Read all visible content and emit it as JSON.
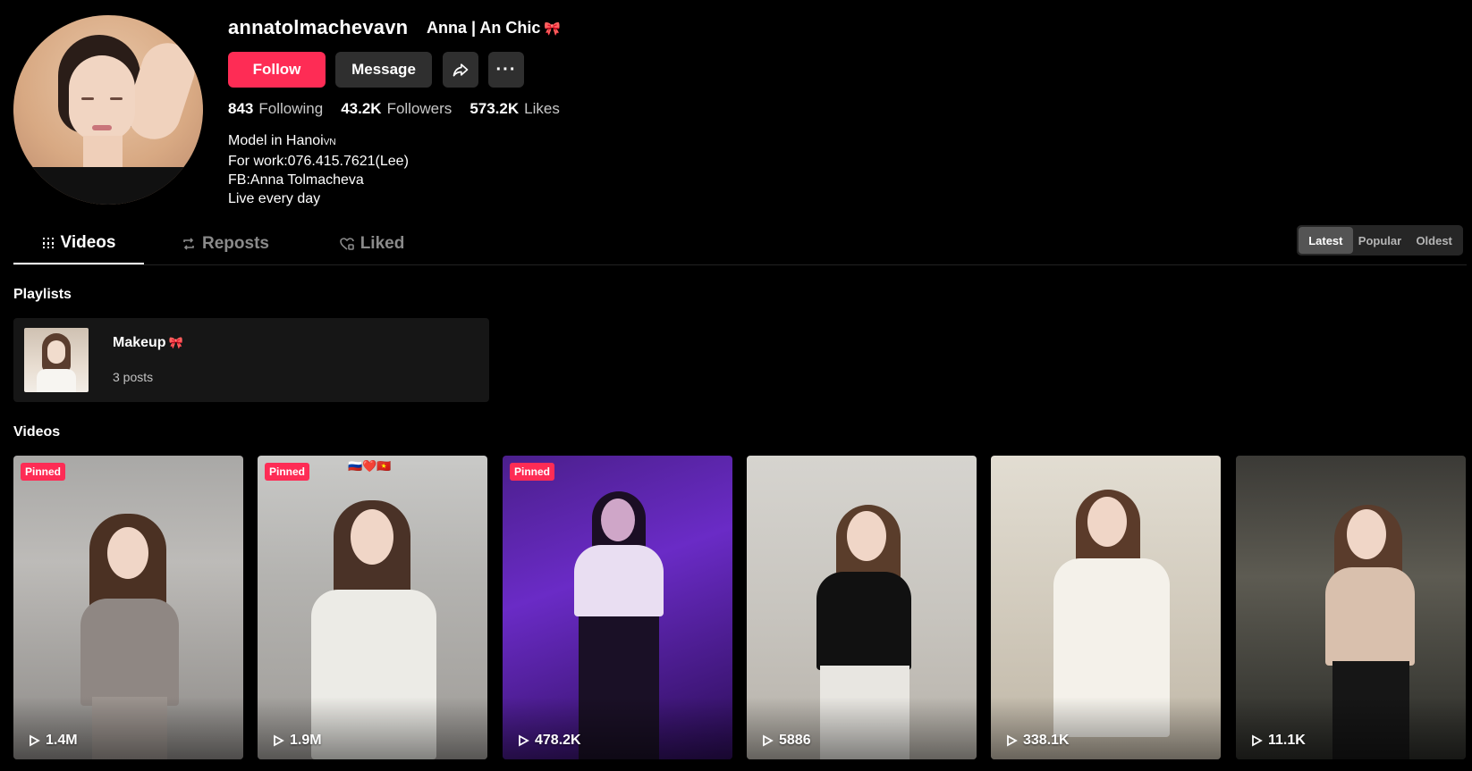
{
  "profile": {
    "username": "annatolmachevavn",
    "nickname": "Anna | An Chic",
    "nickname_emoji": "🎀",
    "follow_label": "Follow",
    "message_label": "Message",
    "more_label": "···",
    "stats": {
      "following_count": "843",
      "following_label": "Following",
      "followers_count": "43.2K",
      "followers_label": "Followers",
      "likes_count": "573.2K",
      "likes_label": "Likes"
    },
    "bio": {
      "line1": "Model in Hanoi",
      "line1_suffix": "VN",
      "line2": "For work:076.415.7621(Lee)",
      "line3": "FB:Anna Tolmacheva",
      "line4": "Live every day"
    }
  },
  "tabs": [
    {
      "label": "Videos",
      "icon": "grid-icon"
    },
    {
      "label": "Reposts",
      "icon": "repost-icon"
    },
    {
      "label": "Liked",
      "icon": "heart-icon"
    }
  ],
  "sort": {
    "options": [
      "Latest",
      "Popular",
      "Oldest"
    ],
    "selected": "Latest"
  },
  "playlists": {
    "title": "Playlists",
    "items": [
      {
        "name": "Makeup",
        "emoji": "🎀",
        "count": "3 posts"
      }
    ]
  },
  "videos": {
    "title": "Videos",
    "items": [
      {
        "badge": "Pinned",
        "views": "1.4M"
      },
      {
        "badge": "Pinned",
        "views": "1.9M",
        "overlay_text": "🇷🇺❤️🇻🇳"
      },
      {
        "badge": "Pinned",
        "views": "478.2K"
      },
      {
        "badge": "",
        "views": "5886"
      },
      {
        "badge": "",
        "views": "338.1K"
      },
      {
        "badge": "",
        "views": "11.1K"
      }
    ]
  },
  "colors": {
    "accent": "#fe2c55",
    "background": "#000000",
    "button_dark": "#2f2f2f"
  }
}
